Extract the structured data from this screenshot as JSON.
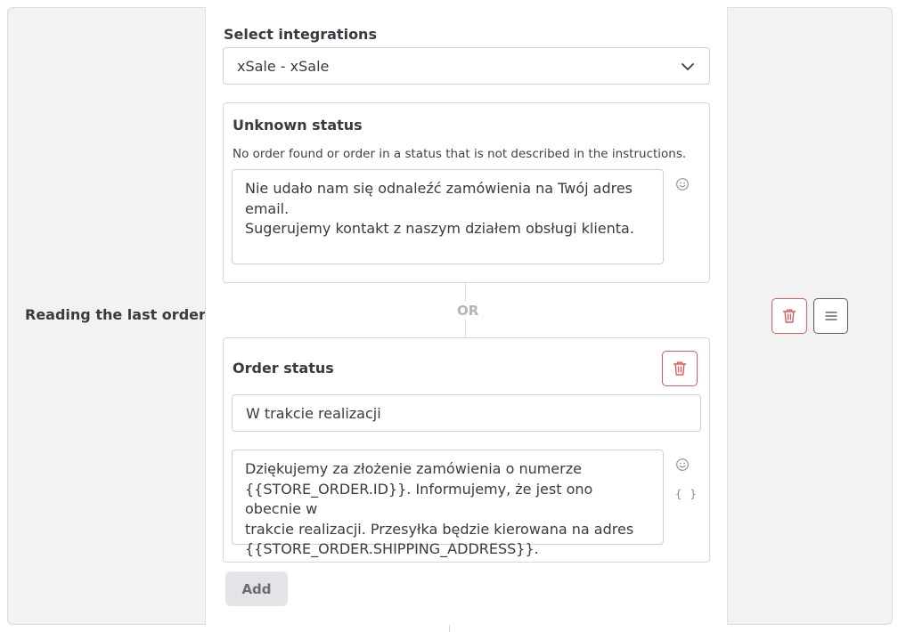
{
  "row": {
    "label": "Reading the last order"
  },
  "integrations": {
    "label": "Select integrations",
    "selected": "xSale - xSale"
  },
  "unknown_status": {
    "title": "Unknown status",
    "description": "No order found or order in a status that is not described in the instructions.",
    "message": "Nie udało nam się odnaleźć zamówienia na Twój adres email.\nSugerujemy kontakt z naszym działem obsługi klienta."
  },
  "separator": {
    "label": "OR"
  },
  "order_status": {
    "title": "Order status",
    "status_value": "W trakcie realizacji",
    "message": "Dziękujemy za złożenie zamówienia o numerze\n{{STORE_ORDER.ID}}. Informujemy, że jest ono obecnie w\ntrakcie realizacji. Przesyłka będzie kierowana na adres\n{{STORE_ORDER.SHIPPING_ADDRESS}}.",
    "variables_icon_text": "{ }"
  },
  "actions": {
    "add_label": "Add"
  },
  "icons": {
    "chevron": "chevron-down-icon",
    "emoji": "emoji-icon",
    "trash": "trash-icon",
    "menu": "menu-icon"
  },
  "colors": {
    "danger": "#e05a5a",
    "panel_bg": "#f2f2f2",
    "separator_text": "#b4b4bc"
  }
}
